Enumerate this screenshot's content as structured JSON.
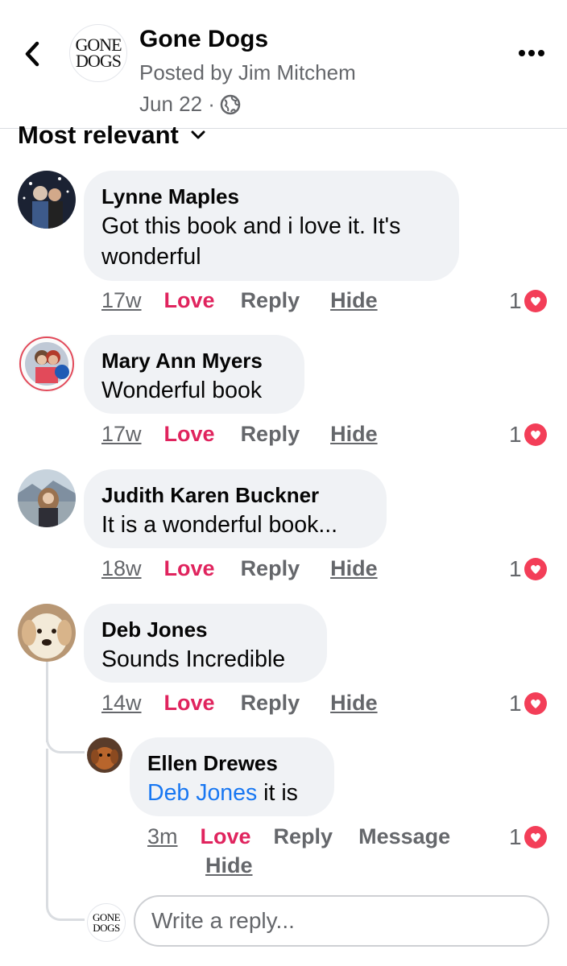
{
  "header": {
    "page_name": "Gone Dogs",
    "posted_by": "Posted by Jim Mitchem",
    "date": "Jun 22 ·",
    "logo_line1": "GONE",
    "logo_line2": "DOGS"
  },
  "sort": {
    "label": "Most relevant"
  },
  "actions": {
    "love": "Love",
    "reply": "Reply",
    "hide": "Hide",
    "message": "Message"
  },
  "comments": [
    {
      "name": "Lynne Maples",
      "text_line1": "Got this book and i love it. It's",
      "text_line2": "wonderful",
      "time": "17w",
      "reactions": "1"
    },
    {
      "name": "Mary Ann Myers",
      "text": "Wonderful book",
      "time": "17w",
      "reactions": "1"
    },
    {
      "name": "Judith Karen Buckner",
      "text": "It is a wonderful book...",
      "time": "18w",
      "reactions": "1"
    },
    {
      "name": "Deb Jones",
      "text": "Sounds Incredible",
      "time": "14w",
      "reactions": "1"
    }
  ],
  "reply": {
    "name": "Ellen Drewes",
    "mention": "Deb Jones",
    "text": " it is",
    "time": "3m",
    "reactions": "1"
  },
  "composer": {
    "placeholder": "Write a reply...",
    "logo_line1": "GONE",
    "logo_line2": "DOGS"
  },
  "colors": {
    "love": "#e0245e",
    "mention": "#1877f2",
    "bubble": "#f0f2f5",
    "muted": "#65676b"
  }
}
